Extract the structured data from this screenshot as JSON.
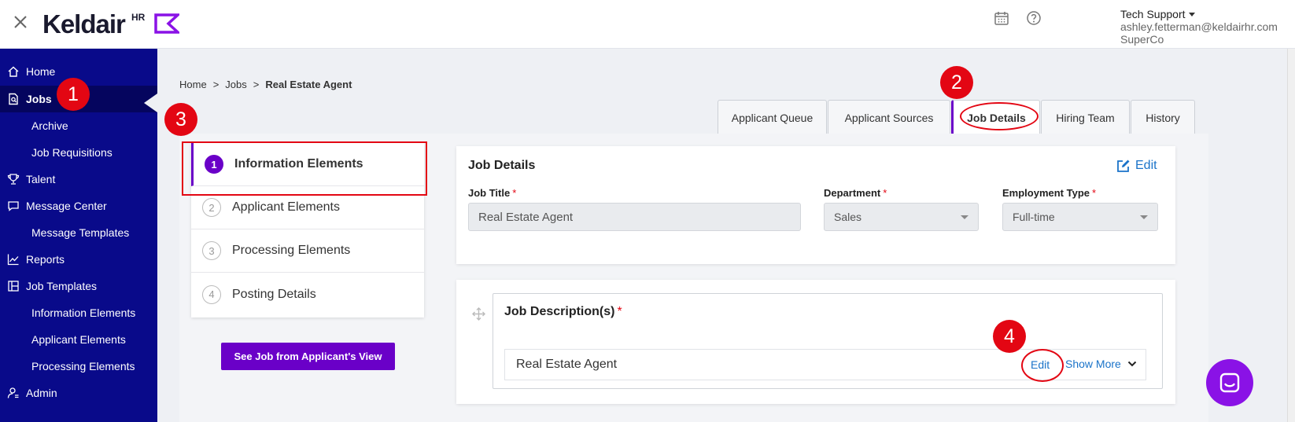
{
  "app": {
    "logo_text": "Keldair",
    "logo_suffix": "HR"
  },
  "user": {
    "name": "Tech Support",
    "email": "ashley.fetterman@keldairhr.com",
    "company": "SuperCo"
  },
  "sidebar": {
    "items": [
      {
        "label": "Home",
        "icon": "home-icon"
      },
      {
        "label": "Jobs",
        "icon": "jobs-icon",
        "active": true
      },
      {
        "label": "Archive"
      },
      {
        "label": "Job Requisitions"
      },
      {
        "label": "Talent",
        "icon": "trophy-icon"
      },
      {
        "label": "Message Center",
        "icon": "chat-icon"
      },
      {
        "label": "Message Templates"
      },
      {
        "label": "Reports",
        "icon": "chart-icon"
      },
      {
        "label": "Job Templates",
        "icon": "template-icon"
      },
      {
        "label": "Information Elements"
      },
      {
        "label": "Applicant Elements"
      },
      {
        "label": "Processing Elements"
      },
      {
        "label": "Admin",
        "icon": "admin-icon"
      }
    ]
  },
  "breadcrumb": {
    "home": "Home",
    "jobs": "Jobs",
    "current": "Real Estate Agent",
    "separator": ">"
  },
  "tabs": [
    {
      "label": "Applicant Queue"
    },
    {
      "label": "Applicant Sources"
    },
    {
      "label": "Job Details",
      "active": true
    },
    {
      "label": "Hiring Team"
    },
    {
      "label": "History"
    }
  ],
  "steps": [
    {
      "num": "1",
      "label": "Information Elements",
      "active": true
    },
    {
      "num": "2",
      "label": "Applicant Elements"
    },
    {
      "num": "3",
      "label": "Processing Elements"
    },
    {
      "num": "4",
      "label": "Posting Details"
    }
  ],
  "applicant_view_button": "See Job from Applicant's View",
  "job_details": {
    "title": "Job Details",
    "edit_label": "Edit",
    "required_mark": "*",
    "job_title_label": "Job Title",
    "job_title_value": "Real Estate Agent",
    "department_label": "Department",
    "department_value": "Sales",
    "employment_type_label": "Employment Type",
    "employment_type_value": "Full-time"
  },
  "job_description": {
    "title": "Job Description(s)",
    "required_mark": "*",
    "row_value": "Real Estate Agent",
    "edit_label": "Edit",
    "show_more_label": "Show More"
  },
  "callouts": [
    "1",
    "2",
    "3",
    "4"
  ],
  "colors": {
    "sidebar_bg": "#090a8a",
    "accent_purple": "#6a00c8",
    "callout_red": "#e30613",
    "link_blue": "#1a73c9"
  }
}
